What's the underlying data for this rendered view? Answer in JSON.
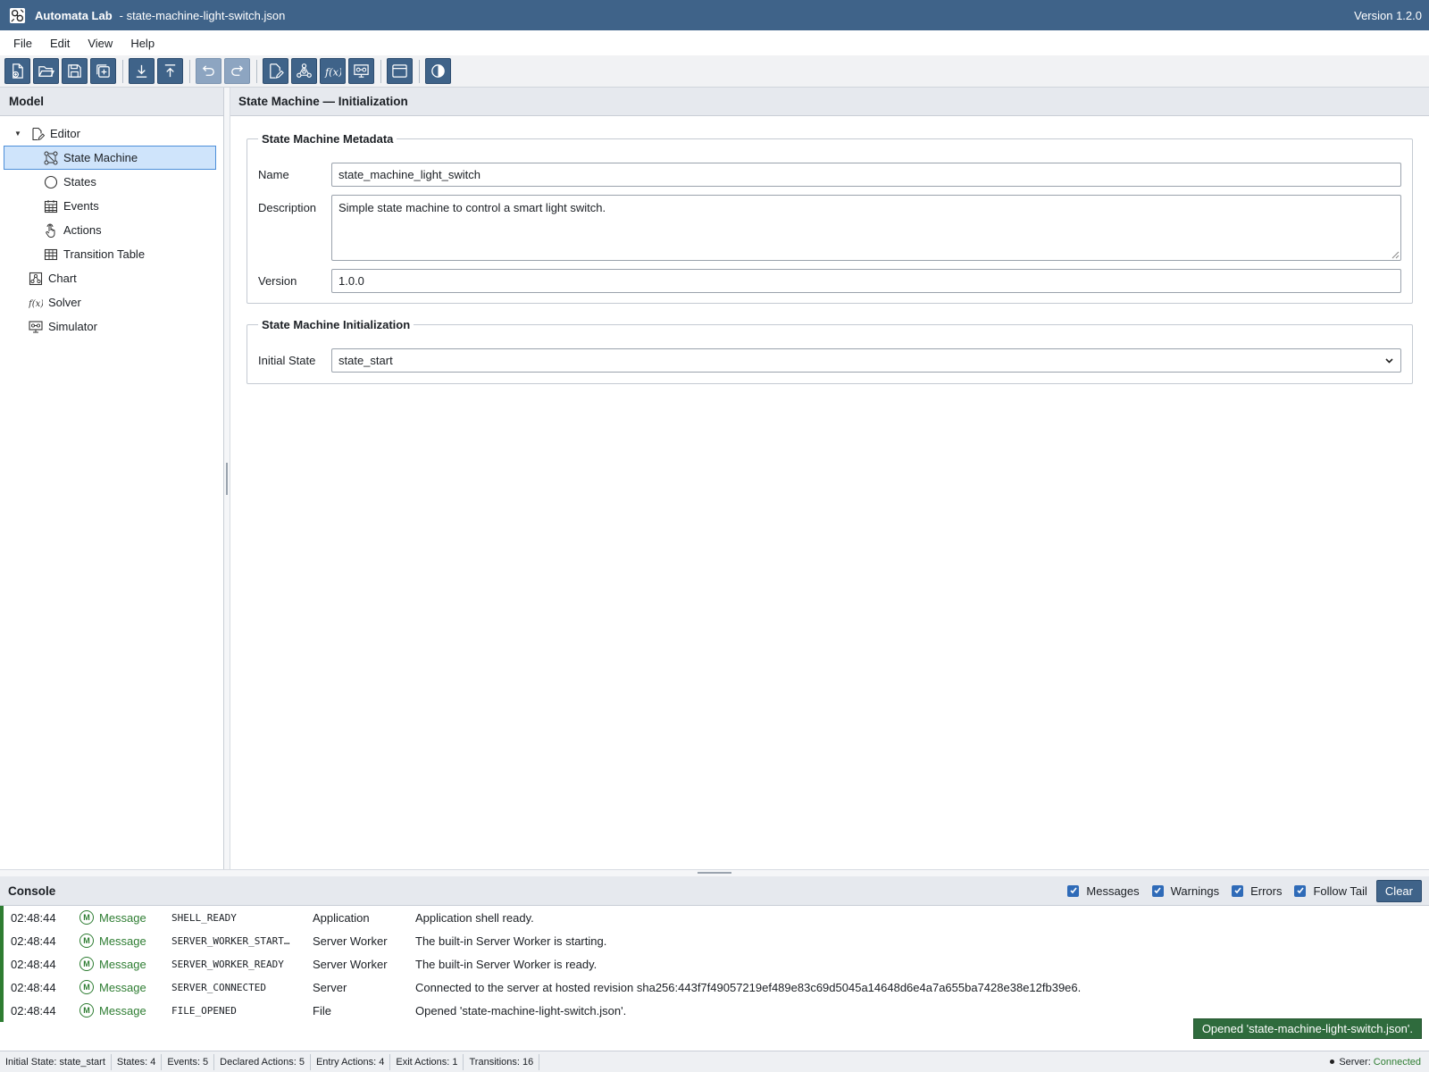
{
  "window": {
    "app_name": "Automata Lab",
    "file_name": "- state-machine-light-switch.json",
    "version": "Version 1.2.0"
  },
  "menu": [
    "File",
    "Edit",
    "View",
    "Help"
  ],
  "sidebar": {
    "title": "Model",
    "items": [
      {
        "label": "Editor",
        "icon": "edit-doc-icon"
      },
      {
        "label": "State Machine",
        "icon": "state-machine-icon"
      },
      {
        "label": "States",
        "icon": "circle-icon"
      },
      {
        "label": "Events",
        "icon": "calendar-icon"
      },
      {
        "label": "Actions",
        "icon": "hand-pointer-icon"
      },
      {
        "label": "Transition Table",
        "icon": "table-icon"
      },
      {
        "label": "Chart",
        "icon": "chart-icon"
      },
      {
        "label": "Solver",
        "icon": "function-icon"
      },
      {
        "label": "Simulator",
        "icon": "simulator-icon"
      }
    ]
  },
  "main": {
    "title": "State Machine — Initialization",
    "metadata": {
      "legend": "State Machine Metadata",
      "name_label": "Name",
      "name_value": "state_machine_light_switch",
      "description_label": "Description",
      "description_value": "Simple state machine to control a smart light switch.",
      "version_label": "Version",
      "version_value": "1.0.0"
    },
    "initialization": {
      "legend": "State Machine Initialization",
      "initial_state_label": "Initial State",
      "initial_state_value": "state_start"
    }
  },
  "console": {
    "title": "Console",
    "filters": {
      "messages": "Messages",
      "warnings": "Warnings",
      "errors": "Errors",
      "follow_tail": "Follow Tail"
    },
    "clear_label": "Clear",
    "rows": [
      {
        "time": "02:48:44",
        "severity": "Message",
        "code": "SHELL_READY",
        "source": "Application",
        "message": "Application shell ready."
      },
      {
        "time": "02:48:44",
        "severity": "Message",
        "code": "SERVER_WORKER_START…",
        "source": "Server Worker",
        "message": "The built-in Server Worker is starting."
      },
      {
        "time": "02:48:44",
        "severity": "Message",
        "code": "SERVER_WORKER_READY",
        "source": "Server Worker",
        "message": "The built-in Server Worker is ready."
      },
      {
        "time": "02:48:44",
        "severity": "Message",
        "code": "SERVER_CONNECTED",
        "source": "Server",
        "message": "Connected to the server at hosted revision sha256:443f7f49057219ef489e83c69d5045a14648d6e4a7a655ba7428e38e12fb39e6."
      },
      {
        "time": "02:48:44",
        "severity": "Message",
        "code": "FILE_OPENED",
        "source": "File",
        "message": "Opened 'state-machine-light-switch.json'."
      }
    ],
    "toast": "Opened 'state-machine-light-switch.json'."
  },
  "statusbar": {
    "initial_state": "Initial State: state_start",
    "states": "States: 4",
    "events": "Events: 5",
    "declared_actions": "Declared Actions: 5",
    "entry_actions": "Entry Actions: 4",
    "exit_actions": "Exit Actions: 1",
    "transitions": "Transitions: 16",
    "server_label": "Server:",
    "server_status": "Connected"
  },
  "colors": {
    "accent": "#3f6389",
    "selection": "#cfe4fb",
    "success": "#2e7d32"
  }
}
